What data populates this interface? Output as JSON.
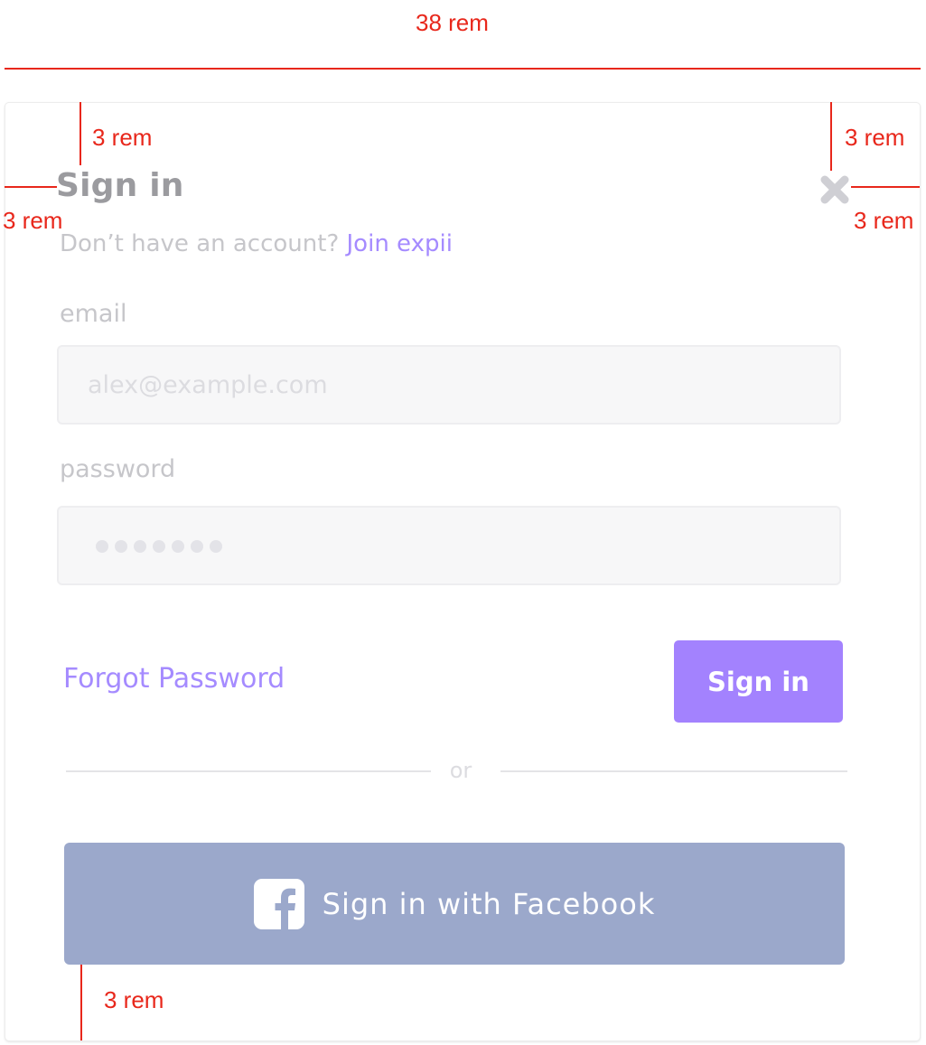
{
  "annotations": {
    "width_label": "38 rem",
    "top_left_label": "3 rem",
    "top_right_label": "3 rem",
    "left_label": "3 rem",
    "right_label": "3 rem",
    "bottom_label": "3 rem"
  },
  "modal": {
    "title": "Sign in",
    "subtitle_text": "Don’t have an account?",
    "subtitle_link": "Join expii",
    "email_label": "email",
    "email_placeholder": "alex@example.com",
    "password_label": "password",
    "password_masked_length": 7,
    "forgot_label": "Forgot Password",
    "signin_button": "Sign in",
    "divider_text": "or",
    "facebook_button": "Sign in with Facebook"
  },
  "icons": {
    "close": "close-icon",
    "facebook": "facebook-icon"
  },
  "colors": {
    "accent": "#a382fe",
    "link": "#a58bff",
    "facebook": "#9ba8cb",
    "annotation": "#e8271b"
  }
}
